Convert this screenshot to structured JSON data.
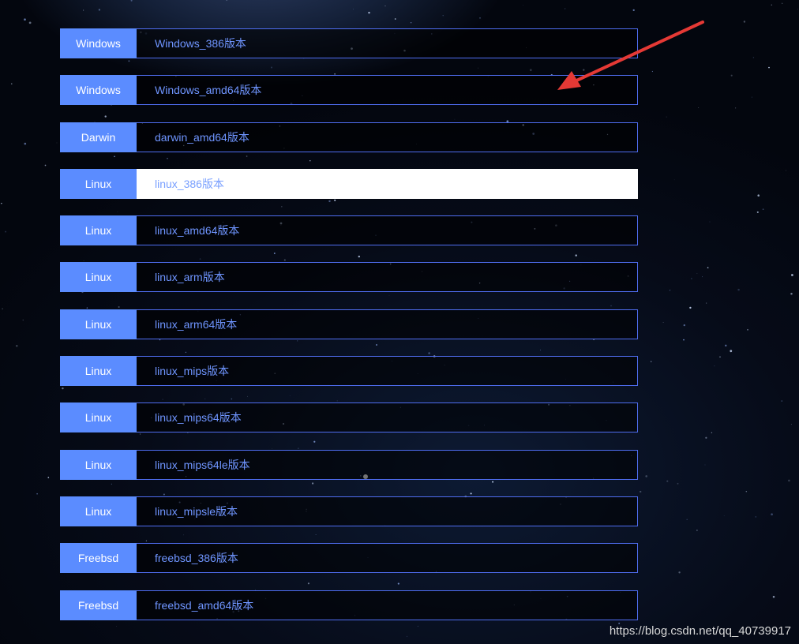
{
  "downloads": [
    {
      "os": "Windows",
      "version": "Windows_386版本"
    },
    {
      "os": "Windows",
      "version": "Windows_amd64版本"
    },
    {
      "os": "Darwin",
      "version": "darwin_amd64版本"
    },
    {
      "os": "Linux",
      "version": "linux_386版本",
      "hovered": true
    },
    {
      "os": "Linux",
      "version": "linux_amd64版本"
    },
    {
      "os": "Linux",
      "version": "linux_arm版本"
    },
    {
      "os": "Linux",
      "version": "linux_arm64版本"
    },
    {
      "os": "Linux",
      "version": "linux_mips版本"
    },
    {
      "os": "Linux",
      "version": "linux_mips64版本"
    },
    {
      "os": "Linux",
      "version": "linux_mips64le版本"
    },
    {
      "os": "Linux",
      "version": "linux_mipsle版本"
    },
    {
      "os": "Freebsd",
      "version": "freebsd_386版本"
    },
    {
      "os": "Freebsd",
      "version": "freebsd_amd64版本"
    }
  ],
  "watermark": "https://blog.csdn.net/qq_40739917",
  "colors": {
    "os_badge": "#5b8cff",
    "version_border": "#4f6df0",
    "version_text": "#6f95ff",
    "annotation_arrow": "#e53935"
  }
}
